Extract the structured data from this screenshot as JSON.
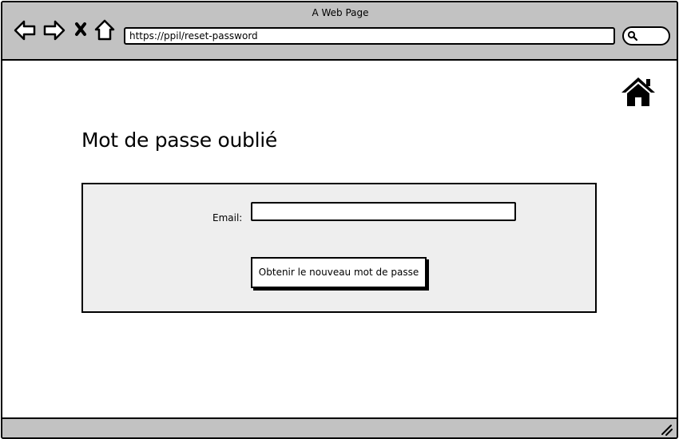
{
  "window": {
    "title": "A Web Page"
  },
  "toolbar": {
    "back_icon": "arrow-left-icon",
    "forward_icon": "arrow-right-icon",
    "stop_icon": "close-icon",
    "home_icon": "home-outline-icon",
    "url": "https://ppil/reset-password",
    "search_icon": "search-icon"
  },
  "page": {
    "home_icon": "home-icon",
    "title": "Mot de passe oublié",
    "form": {
      "email_label": "Email:",
      "email_value": "",
      "submit_label": "Obtenir le nouveau mot de passe"
    }
  },
  "status_bar": {
    "resize_icon": "resize-grip-icon"
  },
  "colors": {
    "chrome": "#c2c2c2",
    "panel": "#eeeeee",
    "stroke": "#000000"
  }
}
